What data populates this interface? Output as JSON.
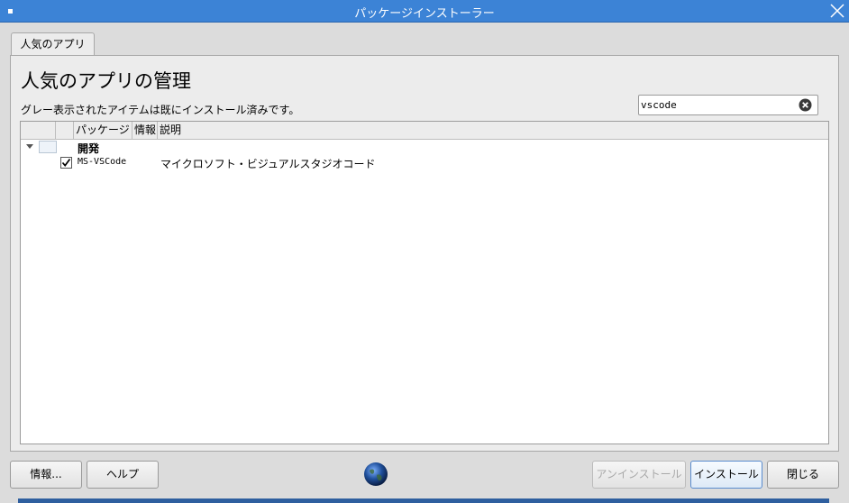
{
  "window": {
    "title": "パッケージインストーラー"
  },
  "tab": {
    "label": "人気のアプリ"
  },
  "panel": {
    "title": "人気のアプリの管理",
    "subtitle": "グレー表示されたアイテムは既にインストール済みです。"
  },
  "search": {
    "value": "vscode"
  },
  "list": {
    "columns": [
      "パッケージ",
      "情報",
      "説明"
    ],
    "group": {
      "label": "開発"
    },
    "items": [
      {
        "package": "MS-VSCode",
        "description": "マイクロソフト・ビジュアルスタジオコード",
        "checked": true
      }
    ]
  },
  "buttons": {
    "info": "情報...",
    "help": "ヘルプ",
    "uninstall": "アンインストール",
    "install": "インストール",
    "close": "閉じる"
  },
  "icons": {
    "window_menu": "window-menu-icon",
    "close": "close-icon",
    "clear_search": "clear-search-icon",
    "expander": "expander-down-icon",
    "checkmark": "checkmark-icon",
    "globe": "globe-icon"
  },
  "colors": {
    "titlebar": "#3c83d6",
    "focus": "#5a8ccf"
  }
}
